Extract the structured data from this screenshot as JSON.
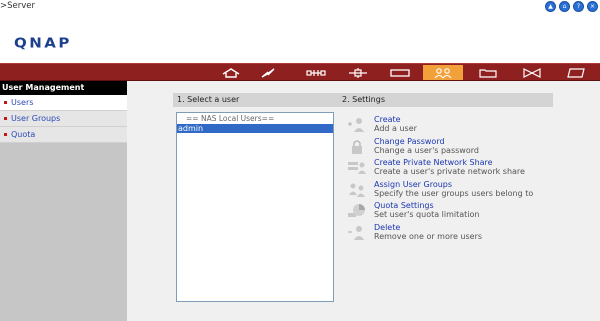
{
  "header": {
    "breadcrumb": ">Server",
    "logo_text": "QNAP",
    "top_icons": [
      {
        "name": "arrow-up-icon",
        "glyph": "▲"
      },
      {
        "name": "home-icon",
        "glyph": "⌂"
      },
      {
        "name": "help-icon",
        "glyph": "?"
      },
      {
        "name": "logout-icon",
        "glyph": "×"
      }
    ]
  },
  "nav": {
    "buttons": [
      {
        "name": "nav-home-icon",
        "active": false
      },
      {
        "name": "nav-system-icon",
        "active": false
      },
      {
        "name": "nav-network-icon",
        "active": false
      },
      {
        "name": "nav-devices-icon",
        "active": false
      },
      {
        "name": "nav-disk-icon",
        "active": false
      },
      {
        "name": "nav-users-icon",
        "active": true
      },
      {
        "name": "nav-share-icon",
        "active": false
      },
      {
        "name": "nav-transfer-icon",
        "active": false
      },
      {
        "name": "nav-log-icon",
        "active": false
      }
    ]
  },
  "sidebar": {
    "title": "User Management",
    "items": [
      {
        "label": "Users",
        "selected": true
      },
      {
        "label": "User Groups",
        "selected": false
      },
      {
        "label": "Quota",
        "selected": false
      }
    ]
  },
  "main": {
    "select_header": "1. Select a user",
    "settings_header": "2. Settings",
    "list": {
      "group_label": "== NAS Local Users==",
      "options": [
        "admin"
      ],
      "selected": "admin"
    },
    "settings": [
      {
        "icon": "add-user-icon",
        "link": "Create",
        "desc": "Add a user"
      },
      {
        "icon": "lock-icon",
        "link": "Change Password",
        "desc": "Change a user's password"
      },
      {
        "icon": "private-share-icon",
        "link": "Create Private Network Share",
        "desc": "Create a user's private network share"
      },
      {
        "icon": "user-groups-icon",
        "link": "Assign User Groups",
        "desc": "Specify the user groups users belong to"
      },
      {
        "icon": "quota-pie-icon",
        "link": "Quota Settings",
        "desc": "Set user's quota limitation"
      },
      {
        "icon": "delete-user-icon",
        "link": "Delete",
        "desc": "Remove one or more users"
      }
    ]
  },
  "colors": {
    "nav_bar": "#8e2020",
    "nav_active": "#f2a13a",
    "link": "#1c38b0",
    "logo": "#1d3f8c"
  }
}
